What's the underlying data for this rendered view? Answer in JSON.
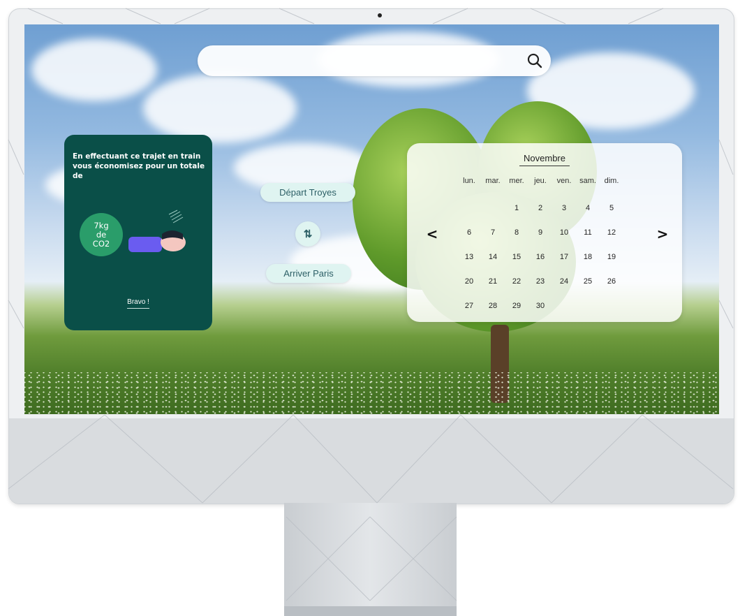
{
  "search": {
    "placeholder": ""
  },
  "co2_card": {
    "message": "En effectuant ce trajet en train vous économisez pour un totale de",
    "value_line1": "7kg",
    "value_line2": "de",
    "value_line3": "CO2",
    "bravo": "Bravo !"
  },
  "route": {
    "depart_label": "Départ Troyes",
    "swap_symbol": "⇅",
    "arrive_label": "Arriver Paris"
  },
  "calendar": {
    "month": "Novembre",
    "prev_symbol": "<",
    "next_symbol": ">",
    "weekdays": [
      "lun.",
      "mar.",
      "mer.",
      "jeu.",
      "ven.",
      "sam.",
      "dim."
    ],
    "days": [
      [
        "",
        "",
        "1",
        "2",
        "3",
        "4",
        "5"
      ],
      [
        "6",
        "7",
        "8",
        "9",
        "10",
        "11",
        "12"
      ],
      [
        "13",
        "14",
        "15",
        "16",
        "17",
        "18",
        "19"
      ],
      [
        "20",
        "21",
        "22",
        "23",
        "24",
        "25",
        "26"
      ],
      [
        "27",
        "28",
        "29",
        "30",
        "",
        "",
        ""
      ]
    ]
  },
  "colors": {
    "card": "#0a4f48",
    "co2_circle": "#2a9d6a",
    "pill": "#dff4f1"
  }
}
